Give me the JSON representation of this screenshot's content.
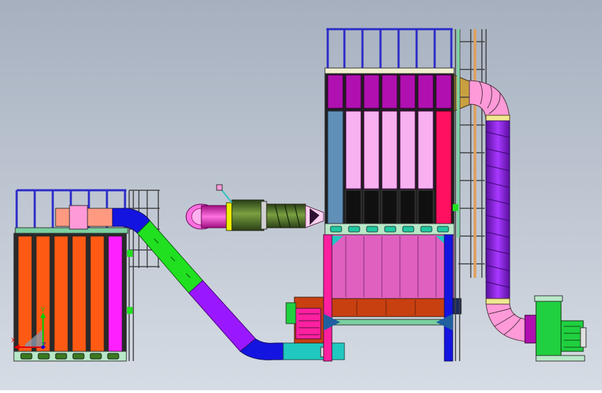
{
  "view": {
    "background_top": "#a6b0bf",
    "background_bottom": "#d6dce4"
  },
  "axis_triad": {
    "y_label": "Y",
    "x_label": "X",
    "z_label": "Z",
    "y_color": "#00d000",
    "x_color": "#e00000",
    "z_color": "#0000e0"
  },
  "colors": {
    "filter_orange": "#ff5a14",
    "filter_magenta": "#ff20ff",
    "railing_blue": "#2a2ac8",
    "duct_green": "#20e020",
    "duct_purple": "#9a18ff",
    "duct_blue": "#1414e0",
    "fan_green": "#20d040",
    "teal": "#20c8c0",
    "pink": "#ff9ad8",
    "crimson": "#ff1060",
    "hopper_pink": "#e060c0",
    "rust": "#c84010",
    "magenta_dark": "#b010b0",
    "lavender": "#f8b0f0",
    "black": "#101010",
    "steel_blue": "#6090b8",
    "olive": "#5a7a30",
    "frame_dark": "#303030"
  }
}
